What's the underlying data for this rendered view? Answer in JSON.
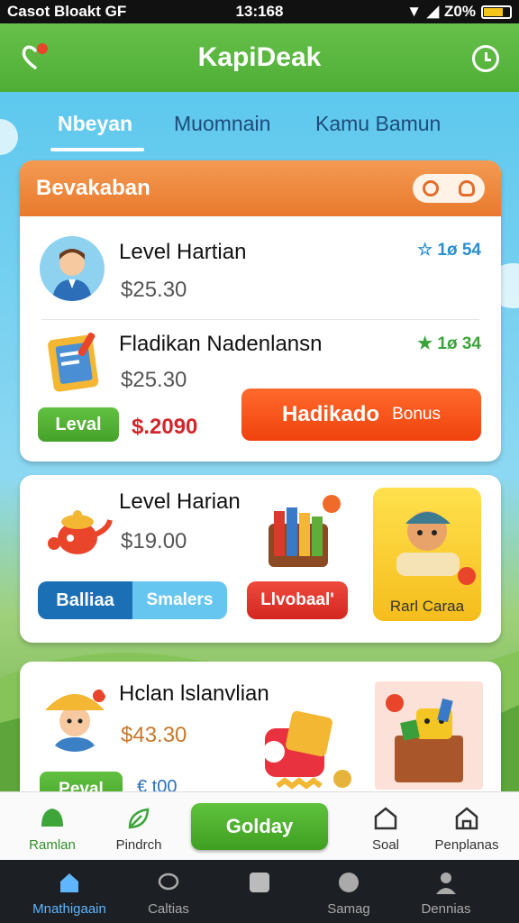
{
  "status_bar": {
    "left": "Casot Bloakt  GF",
    "time": "13:168",
    "battery": "Z0%"
  },
  "app_bar": {
    "title": "KapiDeak"
  },
  "tabs": [
    {
      "label": "Nbeyan",
      "active": true
    },
    {
      "label": "Muomnain",
      "active": false
    },
    {
      "label": "Kamu Bamun",
      "active": false
    }
  ],
  "card1": {
    "header": "Bevakaban",
    "rows": [
      {
        "title": "Level Hartian",
        "price": "$25.30",
        "rating": "☆ 1ø 54",
        "rating_color": "#2a8fd0"
      },
      {
        "title": "Fladikan Nadenlansn",
        "price": "$25.30",
        "rating": "★ 1ø 34",
        "rating_color": "#3ca33a"
      }
    ],
    "level_button": "Leval",
    "promo_price": "$.2090",
    "bonus_button_main": "Hadikado",
    "bonus_button_sub": "Bonus"
  },
  "card2": {
    "title": "Level Harian",
    "price": "$19.00",
    "blue_button_left": "Balliaa",
    "blue_button_right": "Smalers",
    "red_button": "Llvobaal'",
    "tile_label": "Rarl Caraa"
  },
  "card3": {
    "title": "Hclan lslanvlian",
    "price": "$43.30",
    "level_button": "Peval",
    "secondary": "€ t00"
  },
  "bottom_nav": {
    "items": [
      "Ramlan",
      "Pindrch",
      "Soal",
      "Penplanas"
    ],
    "cta": "Golday"
  },
  "system_nav": {
    "items": [
      "Mnathigaain",
      "Caltias",
      "",
      "Samag",
      "Dennias"
    ]
  },
  "colors": {
    "primary_green": "#4fae36",
    "header_orange": "#e97a2d",
    "accent_red": "#f0420e",
    "sky": "#5ec8ee"
  }
}
